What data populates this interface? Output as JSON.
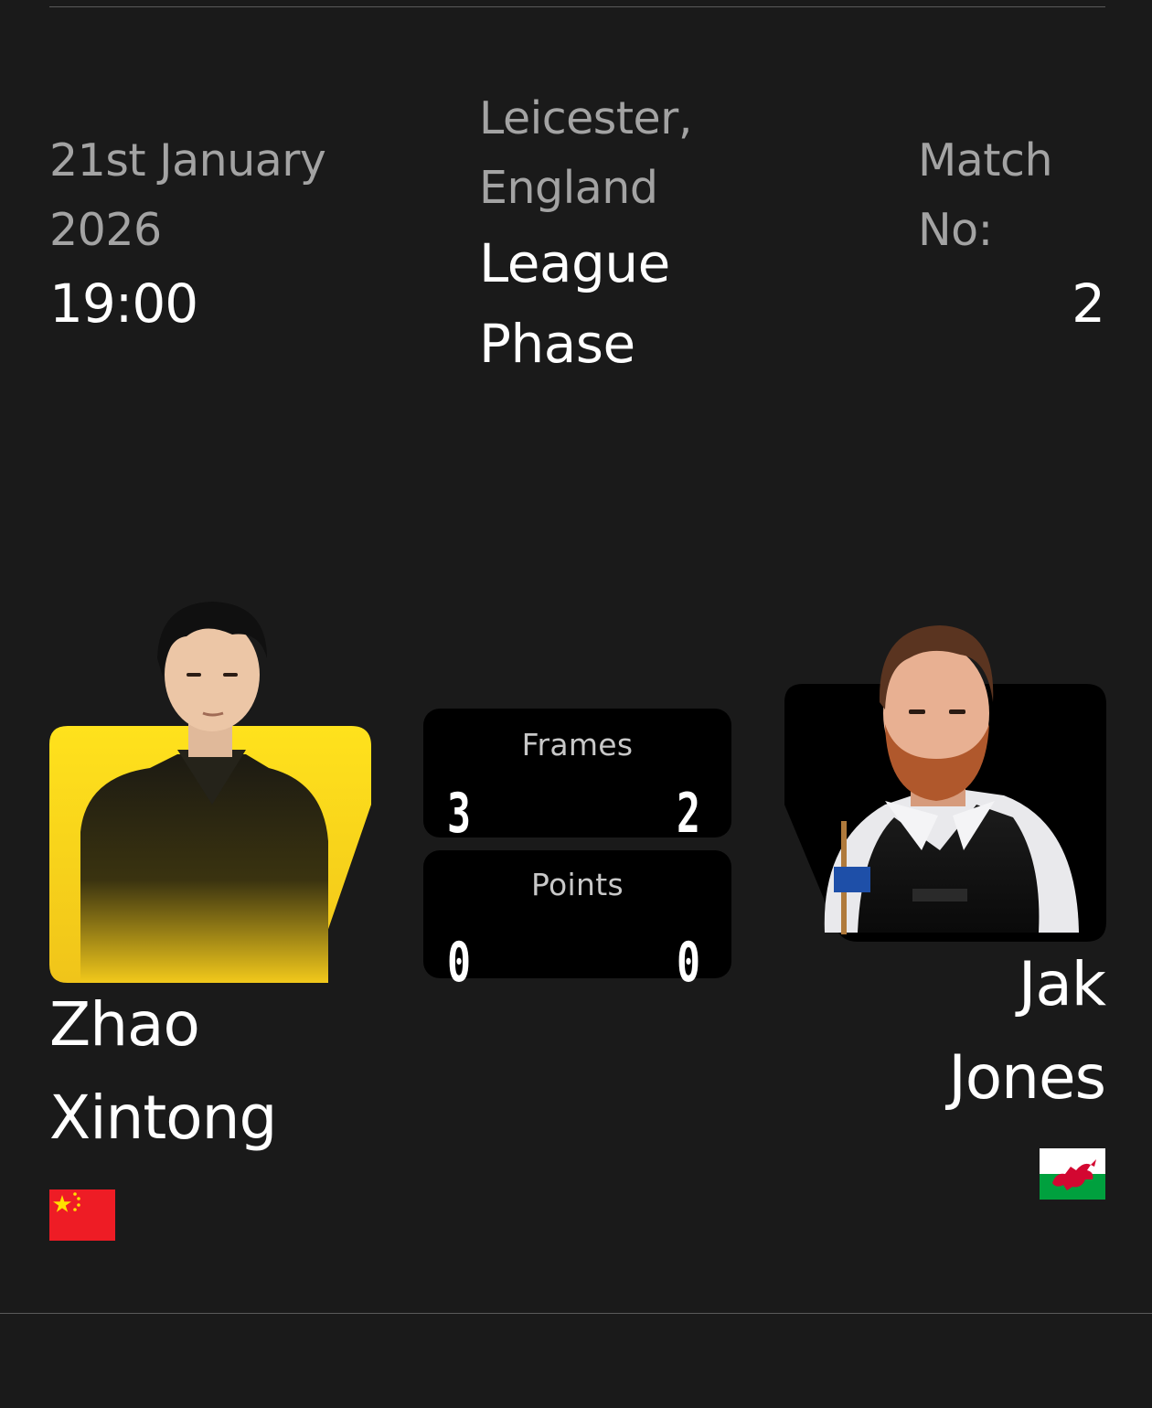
{
  "match": {
    "date_line1": "21st January",
    "date_line2": "2026",
    "time": "19:00",
    "venue_line1": "Leicester,",
    "venue_line2": "England",
    "phase_line1": "League",
    "phase_line2": "Phase",
    "match_label_line1": "Match",
    "match_label_line2": "No:",
    "match_number": "2"
  },
  "scoreboard": {
    "frames_label": "Frames",
    "frames_left": "3",
    "frames_right": "2",
    "points_label": "Points",
    "points_left": "0",
    "points_right": "0"
  },
  "player_left": {
    "first_name": "Zhao",
    "last_name": "Xintong",
    "flag": "china-flag",
    "photo_background": "#f7d31c"
  },
  "player_right": {
    "first_name": "Jak",
    "last_name": "Jones",
    "flag": "wales-flag",
    "photo_background": "#000000"
  }
}
